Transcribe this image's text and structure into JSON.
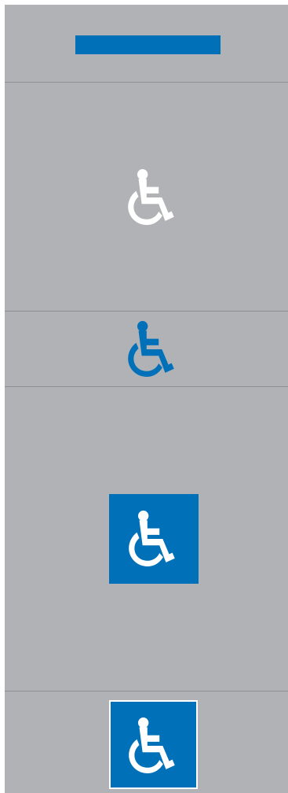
{
  "colors": {
    "background": "#b1b2b6",
    "divider": "#8e8f93",
    "accent_blue": "#0070b8",
    "white": "#ffffff"
  },
  "icons": [
    "wheelchair-icon-white-on-gray",
    "wheelchair-icon-blue-on-gray",
    "wheelchair-icon-white-on-blue",
    "wheelchair-icon-white-on-blue-bordered"
  ]
}
